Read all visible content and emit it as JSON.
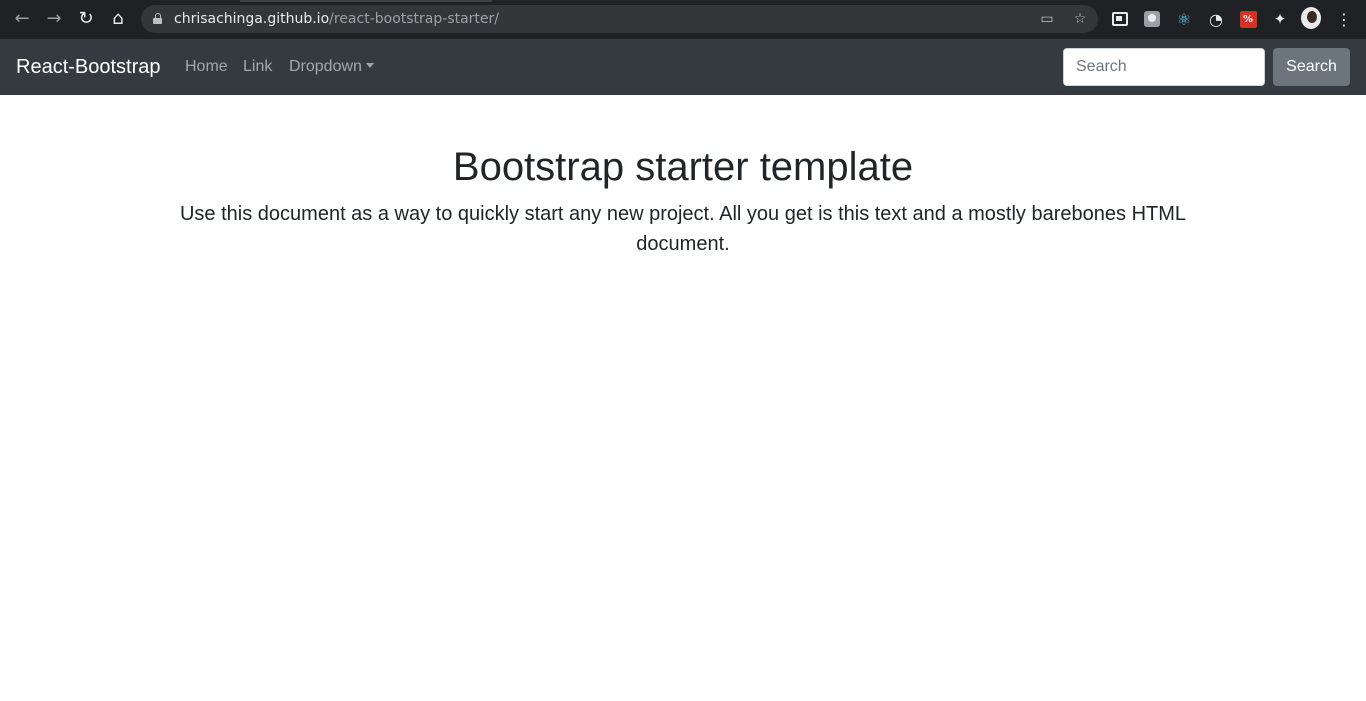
{
  "browser": {
    "url_host": "chrisachinga.github.io",
    "url_path": "/react-bootstrap-starter/",
    "icons": {
      "back": "arrow-left-icon",
      "forward": "arrow-right-icon",
      "reload": "reload-icon",
      "home": "home-icon",
      "lock": "lock-icon",
      "cast": "cast-icon",
      "bookmark": "star-icon",
      "extensions": [
        "window-extension-icon",
        "gray-extension-icon",
        "react-devtools-icon",
        "grammar-extension-icon",
        "red-extension-icon",
        "puzzle-icon"
      ],
      "profile": "avatar-icon",
      "menu": "kebab-menu-icon"
    },
    "colors": {
      "chrome_bg": "#202124",
      "omnibox_bg": "#35363a"
    }
  },
  "navbar": {
    "brand": "React-Bootstrap",
    "links": [
      "Home",
      "Link",
      "Dropdown"
    ],
    "search_placeholder": "Search",
    "search_button": "Search",
    "colors": {
      "bg": "#343a40",
      "button": "#6c757d"
    }
  },
  "main": {
    "title": "Bootstrap starter template",
    "lead": "Use this document as a way to quickly start any new project. All you get is this text and a mostly barebones HTML document."
  }
}
